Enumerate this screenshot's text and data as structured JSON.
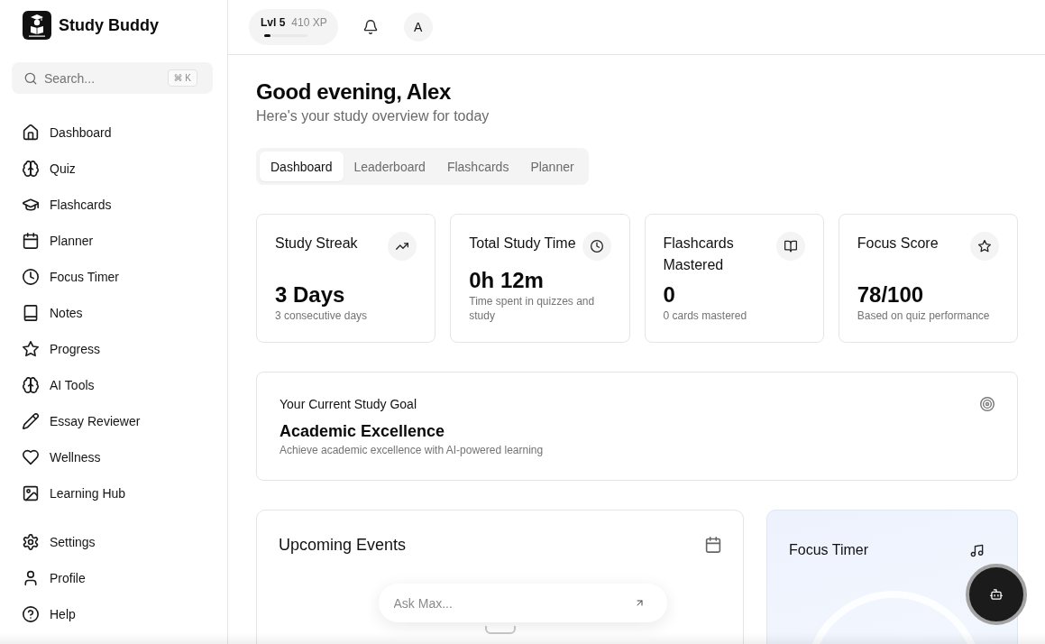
{
  "sidebar": {
    "brand": "Study Buddy",
    "search": {
      "placeholder": "Search...",
      "shortcut": "⌘ K"
    },
    "nav": [
      "Dashboard",
      "Quiz",
      "Flashcards",
      "Planner",
      "Focus Timer",
      "Notes",
      "Progress",
      "AI Tools",
      "Essay Reviewer",
      "Wellness",
      "Learning Hub"
    ],
    "footer": [
      "Settings",
      "Profile",
      "Help"
    ]
  },
  "header": {
    "level_badge": {
      "label": "Lvl 5",
      "xp": "410 XP",
      "level": 0.15
    },
    "avatar": "A"
  },
  "greeting": {
    "title": "Good evening, Alex",
    "subtitle": "Here's your study overview for today"
  },
  "tabs": [
    {
      "label": "Dashboard",
      "selected": true
    },
    {
      "label": "Leaderboard",
      "selected": false
    },
    {
      "label": "Flashcards",
      "selected": false
    },
    {
      "label": "Planner",
      "selected": false
    }
  ],
  "stats": [
    {
      "title": "Study Streak",
      "value": "3 Days",
      "note": "3 consecutive days"
    },
    {
      "title": "Total Study Time",
      "value": "0h 12m",
      "note": "Time spent in quizzes and study"
    },
    {
      "title": "Flashcards Mastered",
      "value": "0",
      "note": "0 cards mastered"
    },
    {
      "title": "Focus Score",
      "value": "78/100",
      "note": "Based on quiz performance"
    }
  ],
  "goal": {
    "heading": "Your Current Study Goal",
    "title": "Academic Excellence",
    "description": "Achieve academic excellence with AI-powered learning"
  },
  "upcoming_events": {
    "title": "Upcoming Events"
  },
  "focus_timer": {
    "title": "Focus Timer"
  },
  "chat": {
    "placeholder": "Ask Max..."
  }
}
